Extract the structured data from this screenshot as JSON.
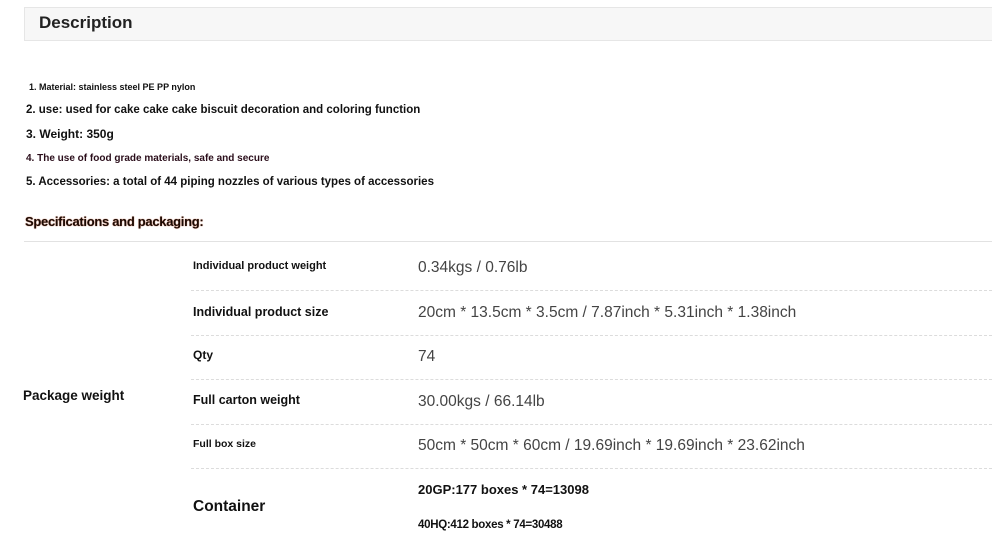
{
  "description": {
    "title": "Description",
    "features": [
      "1. Material: stainless steel PE PP nylon",
      "2. use: used for cake cake cake biscuit decoration and coloring function",
      "3. Weight: 350g",
      "4. The use of food grade materials, safe and secure",
      "5. Accessories: a total of 44 piping nozzles of various types of accessories"
    ]
  },
  "specs": {
    "title": "Specifications and packaging:",
    "group_label": "Package weight",
    "rows": [
      {
        "label": "Individual product weight",
        "value": "0.34kgs / 0.76lb"
      },
      {
        "label": "Individual product size",
        "value": "20cm * 13.5cm * 3.5cm / 7.87inch * 5.31inch * 1.38inch"
      },
      {
        "label": "Qty",
        "value": "74"
      },
      {
        "label": "Full carton weight",
        "value": "30.00kgs / 66.14lb"
      },
      {
        "label": "Full box size",
        "value": "50cm * 50cm * 60cm / 19.69inch * 19.69inch * 23.62inch"
      }
    ],
    "container": {
      "label": "Container",
      "values": [
        "20GP:177 boxes * 74=13098",
        "40HQ:412 boxes * 74=30488"
      ]
    }
  }
}
